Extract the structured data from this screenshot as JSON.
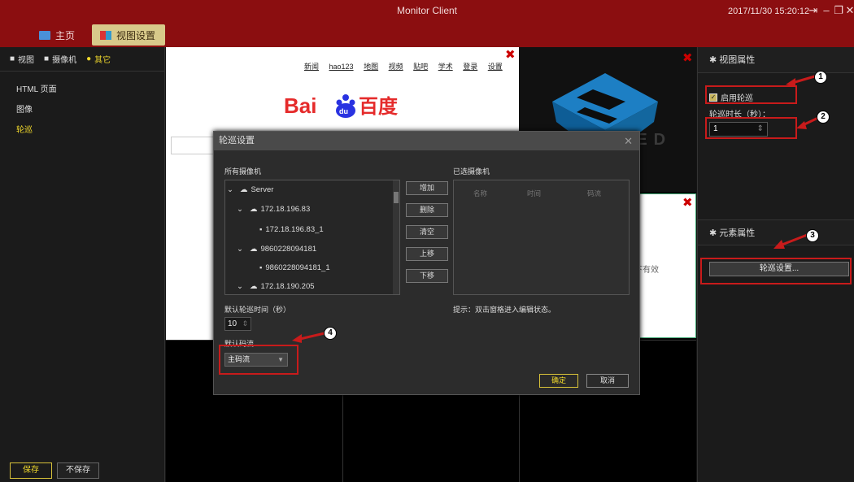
{
  "app": {
    "title": "Monitor Client",
    "datetime": "2017/11/30 15:20:12",
    "window_icons": [
      "logout-icon",
      "minimize-icon",
      "restore-icon",
      "close-icon"
    ]
  },
  "topnav": {
    "home": "主页",
    "view_settings": "视图设置"
  },
  "left": {
    "tabs": [
      "视图",
      "摄像机",
      "其它"
    ],
    "items": [
      "HTML 页面",
      "图像",
      "轮巡"
    ],
    "save": "保存",
    "nosave": "不保存"
  },
  "browser": {
    "links": [
      "新闻",
      "hao123",
      "地图",
      "视频",
      "贴吧",
      "学术",
      "登录",
      "设置"
    ],
    "logo_text": "Bai百度"
  },
  "center": {
    "partial_text": "下有效",
    "brand_text": "EED"
  },
  "right": {
    "view_props_title": "视图属性",
    "enable_patrol": "启用轮巡",
    "patrol_duration_label": "轮巡时长（秒）：",
    "patrol_duration_value": "1",
    "element_props_title": "元素属性",
    "patrol_settings_btn": "轮巡设置..."
  },
  "dialog": {
    "title": "轮巡设置",
    "all_cameras": "所有摄像机",
    "selected_cameras": "已选摄像机",
    "tree": [
      {
        "label": "Server"
      },
      {
        "label": "172.18.196.83"
      },
      {
        "label": "172.18.196.83_1"
      },
      {
        "label": "9860228094181"
      },
      {
        "label": "9860228094181_1"
      },
      {
        "label": "172.18.190.205"
      }
    ],
    "buttons": [
      "增加",
      "删除",
      "清空",
      "上移",
      "下移"
    ],
    "columns": [
      "名称",
      "时间",
      "码流"
    ],
    "hint": "提示：双击窗格进入编辑状态。",
    "default_time_label": "默认轮巡时间（秒）",
    "default_time_value": "10",
    "default_stream_label": "默认码流",
    "default_stream_value": "主码流",
    "ok": "确定",
    "cancel": "取消"
  },
  "annotations": [
    "1",
    "2",
    "3",
    "4"
  ],
  "colors": {
    "titlebar": "#8b0e10",
    "accent": "#f0d82c",
    "annotation_red": "#c81b1b"
  }
}
